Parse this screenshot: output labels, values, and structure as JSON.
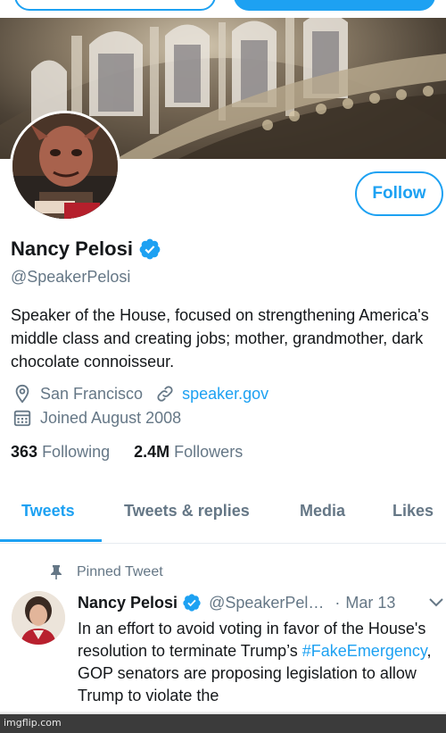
{
  "profile": {
    "name": "Nancy Pelosi",
    "handle": "@SpeakerPelosi",
    "bio": "Speaker of the House, focused on strengthening America's middle class and creating jobs; mother, grandmother, dark chocolate connoisseur.",
    "location": "San Francisco",
    "website": "speaker.gov",
    "joined": "Joined August 2008",
    "following_count": "363",
    "following_label": "Following",
    "followers_count": "2.4M",
    "followers_label": "Followers",
    "follow_button": "Follow"
  },
  "tabs": [
    {
      "label": "Tweets",
      "active": true
    },
    {
      "label": "Tweets & replies",
      "active": false
    },
    {
      "label": "Media",
      "active": false
    },
    {
      "label": "Likes",
      "active": false
    }
  ],
  "pinned_tweet": {
    "pinned_label": "Pinned Tweet",
    "author": "Nancy Pelosi",
    "handle": "@SpeakerPel…",
    "separator": "·",
    "date": "Mar 13",
    "text_part1": "In an effort to avoid voting in favor of the House's resolution to terminate Trump’s ",
    "hashtag": "#FakeEmergency",
    "text_part2": ", GOP senators are proposing legislation to allow Trump to violate the"
  },
  "watermark": "imgflip.com",
  "colors": {
    "accent": "#1da1f2",
    "secondary_text": "#657786",
    "primary_text": "#14171a"
  },
  "icons": [
    "verified-badge-icon",
    "location-pin-icon",
    "link-icon",
    "calendar-icon",
    "pin-icon",
    "chevron-down-icon"
  ]
}
